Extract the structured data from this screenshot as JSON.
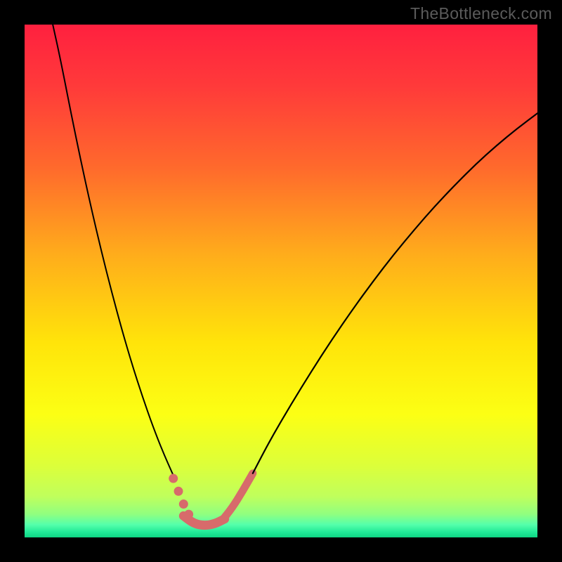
{
  "watermark": "TheBottleneck.com",
  "chart_data": {
    "type": "line",
    "title": "",
    "xlabel": "",
    "ylabel": "",
    "xlim": [
      0,
      100
    ],
    "ylim": [
      0,
      100
    ],
    "grid": false,
    "legend": false,
    "background_gradient_stops": [
      {
        "offset": 0.0,
        "color": "#ff203f"
      },
      {
        "offset": 0.12,
        "color": "#ff3a3a"
      },
      {
        "offset": 0.28,
        "color": "#ff6a2c"
      },
      {
        "offset": 0.45,
        "color": "#ffad1b"
      },
      {
        "offset": 0.62,
        "color": "#ffe40a"
      },
      {
        "offset": 0.76,
        "color": "#fcff14"
      },
      {
        "offset": 0.86,
        "color": "#dcff3a"
      },
      {
        "offset": 0.92,
        "color": "#c0ff5c"
      },
      {
        "offset": 0.955,
        "color": "#90ff80"
      },
      {
        "offset": 0.975,
        "color": "#55ffab"
      },
      {
        "offset": 0.99,
        "color": "#20e997"
      },
      {
        "offset": 1.0,
        "color": "#0ed583"
      }
    ],
    "series": [
      {
        "name": "left-branch",
        "stroke": "#000000",
        "stroke_width": 2,
        "x": [
          5.5,
          7,
          9,
          11,
          13,
          15,
          17,
          19,
          21,
          23,
          25,
          27,
          29
        ],
        "y": [
          100,
          93.2,
          83.0,
          73.3,
          64.2,
          55.7,
          47.8,
          40.4,
          33.6,
          27.4,
          21.7,
          16.6,
          12.1
        ]
      },
      {
        "name": "left-branch-marker-dots",
        "stroke": "#d76b6b",
        "marker_radius": 6.5,
        "x": [
          29.0,
          30.0,
          31.0,
          32.0
        ],
        "y": [
          11.5,
          9.0,
          6.5,
          4.5
        ]
      },
      {
        "name": "valley-floor",
        "stroke": "#d76b6b",
        "stroke_width": 13,
        "x": [
          31.0,
          33.0,
          35.0,
          37.0,
          39.0
        ],
        "y": [
          4.2,
          2.7,
          2.3,
          2.6,
          3.6
        ]
      },
      {
        "name": "right-rise-thick",
        "stroke": "#d76b6b",
        "stroke_width": 11,
        "x": [
          38.5,
          40.5,
          42.5,
          44.5
        ],
        "y": [
          3.3,
          5.8,
          9.0,
          12.5
        ]
      },
      {
        "name": "right-branch",
        "stroke": "#000000",
        "stroke_width": 2.2,
        "x": [
          44.5,
          48,
          52,
          56,
          60,
          64,
          68,
          72,
          76,
          80,
          84,
          88,
          92,
          96,
          100
        ],
        "y": [
          12.5,
          19.2,
          26.0,
          32.5,
          38.7,
          44.5,
          50.0,
          55.2,
          60.0,
          64.6,
          68.8,
          72.8,
          76.4,
          79.7,
          82.7
        ]
      }
    ]
  }
}
